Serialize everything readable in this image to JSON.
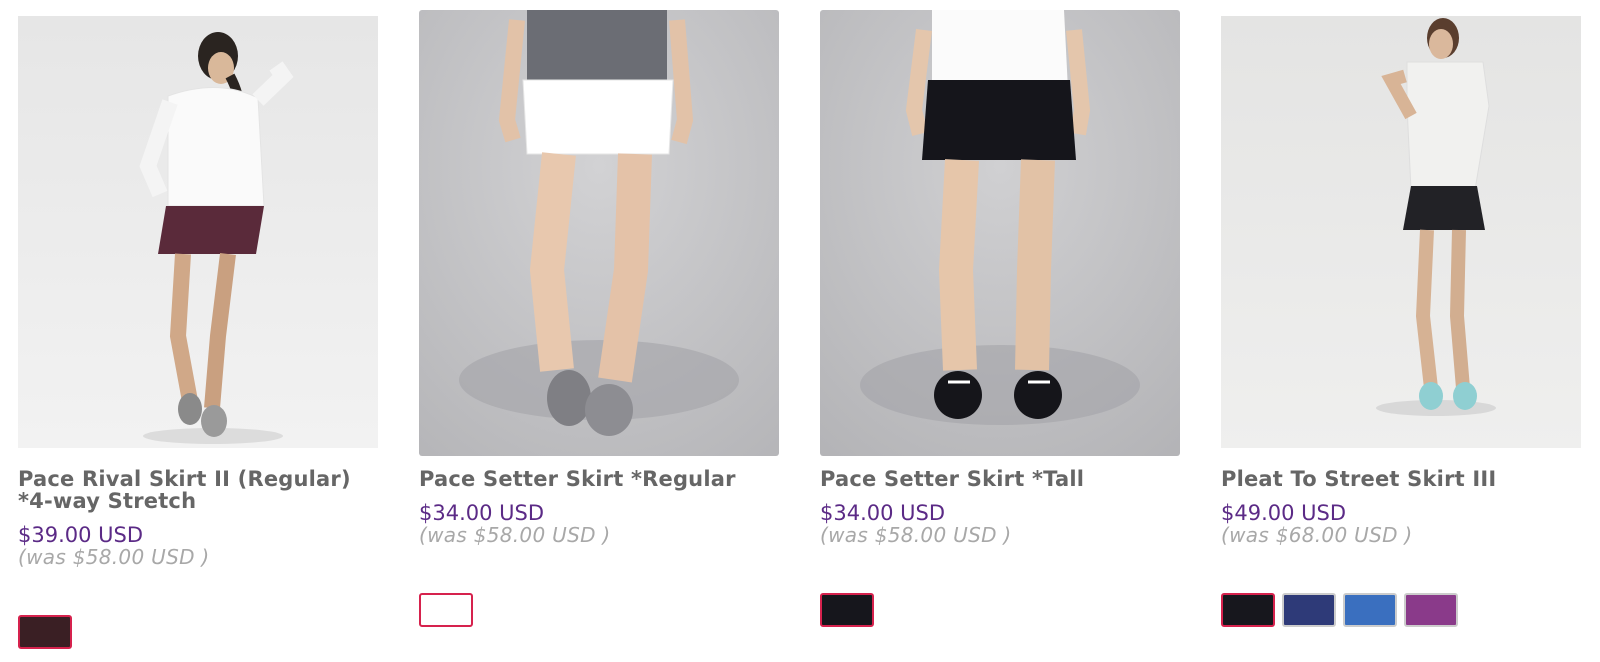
{
  "products": [
    {
      "name": "Pace Rival Skirt II (Regular) *4-way Stretch",
      "price": "$39.00 USD",
      "was_price": "(was $58.00 USD )",
      "image_icon": "product-photo",
      "swatches": [
        {
          "color": "#3a1f24",
          "selected": true
        }
      ]
    },
    {
      "name": "Pace Setter Skirt *Regular",
      "price": "$34.00 USD",
      "was_price": "(was $58.00 USD )",
      "image_icon": "product-photo",
      "swatches": [
        {
          "color": "#ffffff",
          "selected": true
        }
      ]
    },
    {
      "name": "Pace Setter Skirt *Tall",
      "price": "$34.00 USD",
      "was_price": "(was $58.00 USD )",
      "image_icon": "product-photo",
      "swatches": [
        {
          "color": "#16161c",
          "selected": true
        }
      ]
    },
    {
      "name": "Pleat To Street Skirt III",
      "price": "$49.00 USD",
      "was_price": "(was $68.00 USD )",
      "image_icon": "product-photo",
      "swatches": [
        {
          "color": "#17171d",
          "selected": true
        },
        {
          "color": "#2e3a78",
          "selected": false
        },
        {
          "color": "#3a6fbf",
          "selected": false
        },
        {
          "color": "#8a3a8a",
          "selected": false
        }
      ]
    }
  ],
  "colors": {
    "price": "#5b2a86",
    "name": "#666666",
    "was_price": "#a8a8a8",
    "selected_border": "#d6224d"
  }
}
